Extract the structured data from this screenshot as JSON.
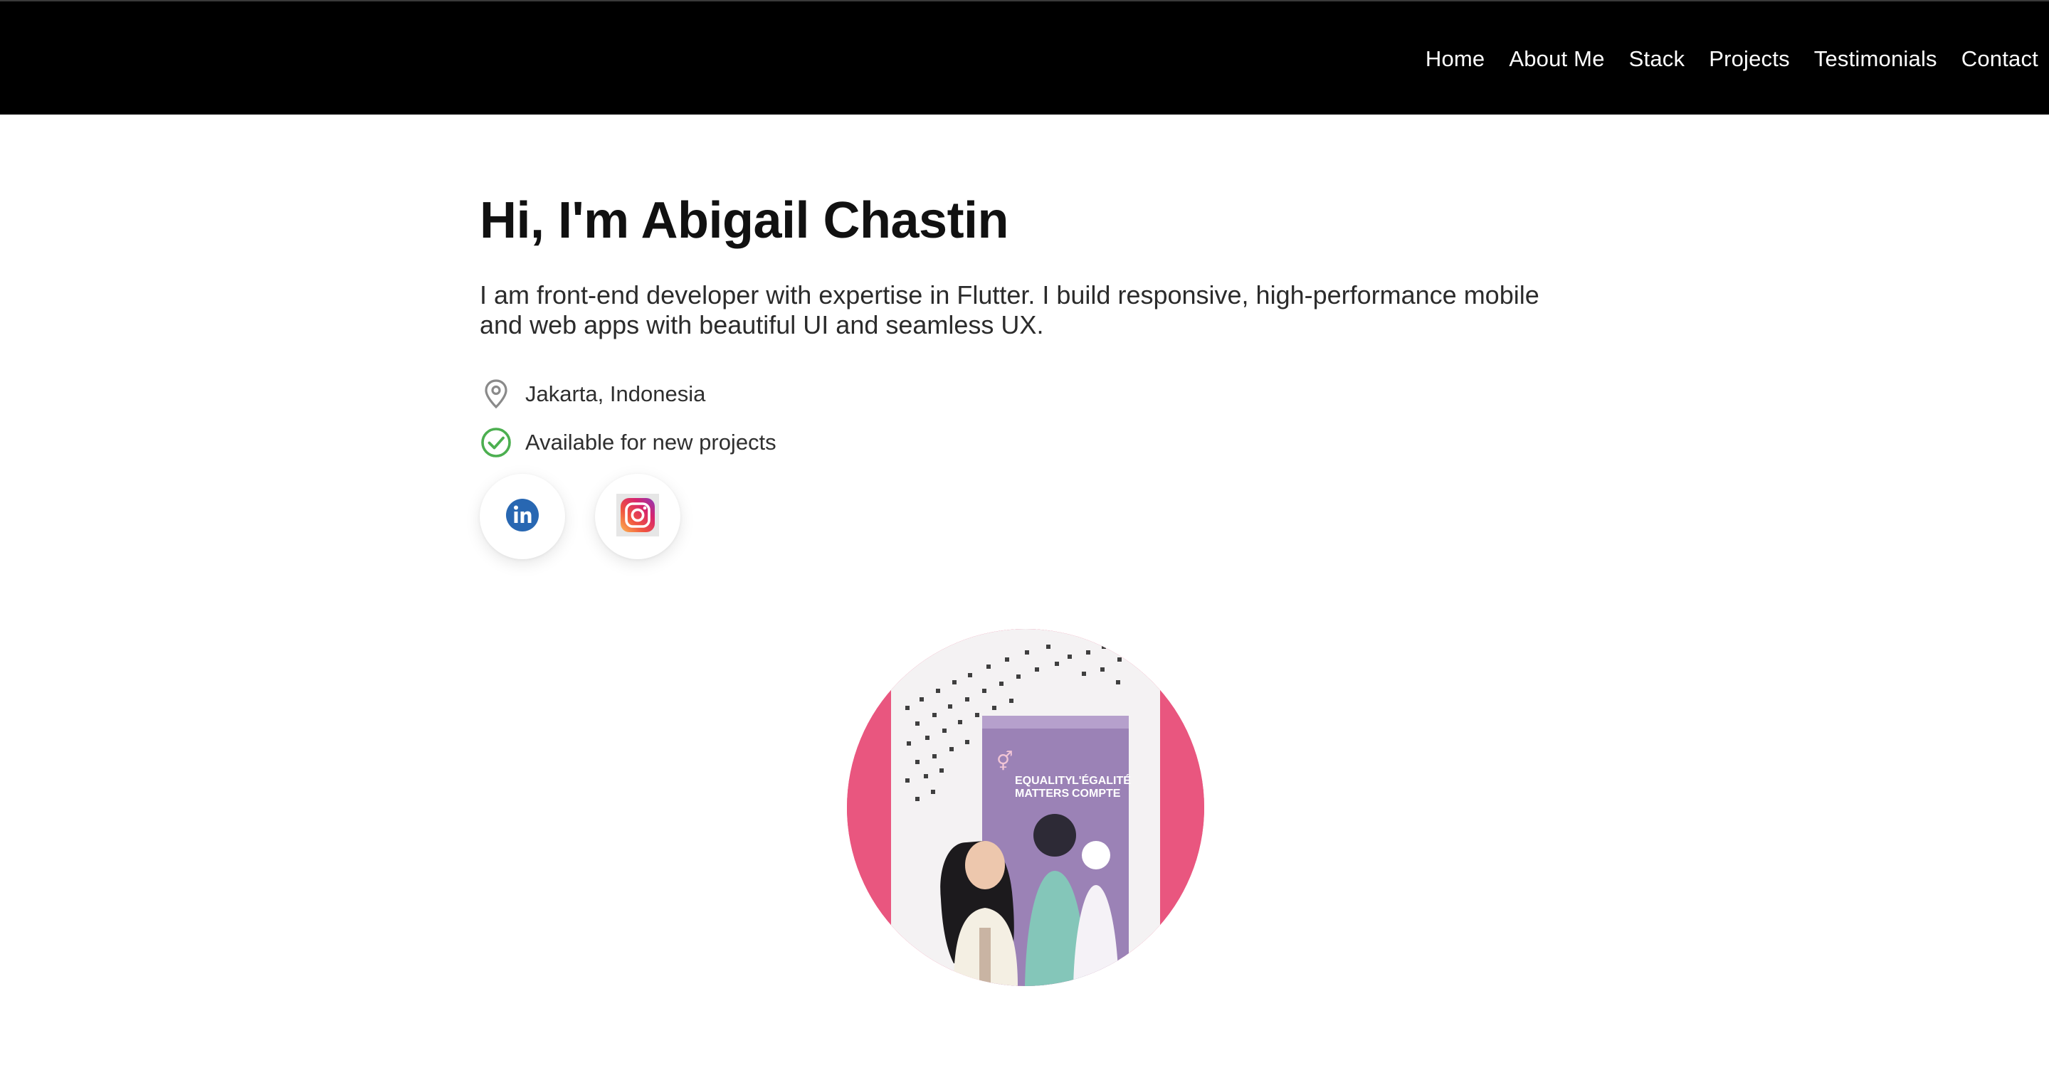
{
  "nav": {
    "items": [
      "Home",
      "About Me",
      "Stack",
      "Projects",
      "Testimonials",
      "Contact"
    ]
  },
  "hero": {
    "title": "Hi, I'm Abigail Chastin",
    "intro": "I am front-end developer with expertise in Flutter. I build responsive, high-performance mobile and web apps with beautiful UI and seamless UX.",
    "location": "Jakarta, Indonesia",
    "availability": "Available for new projects"
  },
  "socials": [
    {
      "name": "linkedin-icon",
      "label": "in"
    },
    {
      "name": "instagram-icon"
    }
  ],
  "portrait": {
    "banner_text_left": "EQUALITY MATTERS",
    "banner_text_right": "L'ÉGALITÉ COMPTE"
  },
  "colors": {
    "nav_bg": "#000000",
    "accent_pink": "#e9567f",
    "check_green": "#4caf50",
    "linkedin_blue": "#2867b2"
  }
}
